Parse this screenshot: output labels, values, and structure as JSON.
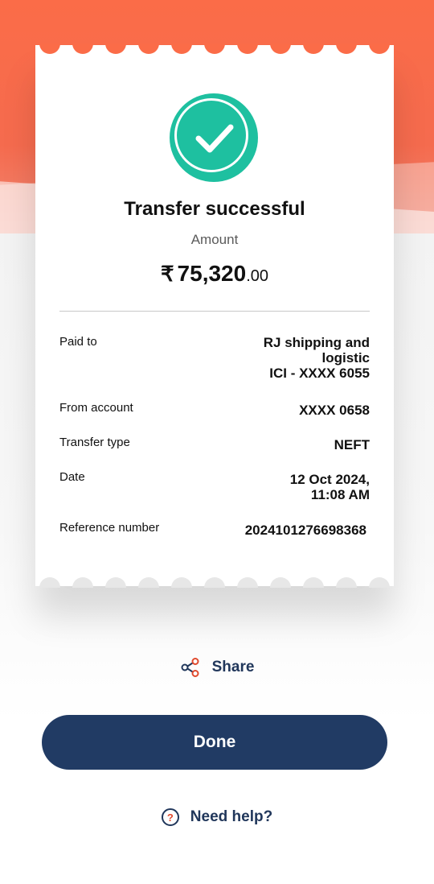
{
  "receipt": {
    "title": "Transfer successful",
    "amount_label": "Amount",
    "amount": {
      "currency_symbol": "₹",
      "main": "75,320",
      "decimal": ".00"
    },
    "rows": [
      {
        "label": "Paid to",
        "value_lines": [
          "RJ shipping and",
          "logistic",
          "ICI - XXXX 6055"
        ]
      },
      {
        "label": "From account",
        "value_lines": [
          "XXXX 0658"
        ]
      },
      {
        "label": "Transfer type",
        "value_lines": [
          "NEFT"
        ]
      },
      {
        "label": "Date",
        "value_lines": [
          "12 Oct 2024,",
          "11:08 AM"
        ]
      },
      {
        "label": "Reference number",
        "value_lines": [
          "2024101276698368"
        ]
      }
    ]
  },
  "actions": {
    "share_label": "Share",
    "done_label": "Done",
    "help_label": "Need help?",
    "help_icon_glyph": "?"
  },
  "icons": {
    "success": "check-circle-icon",
    "share": "share-icon",
    "help": "question-circle-icon"
  },
  "colors": {
    "hero": "#fb6c48",
    "success": "#1ec0a0",
    "primary": "#213b64",
    "accent": "#e04a2e"
  }
}
